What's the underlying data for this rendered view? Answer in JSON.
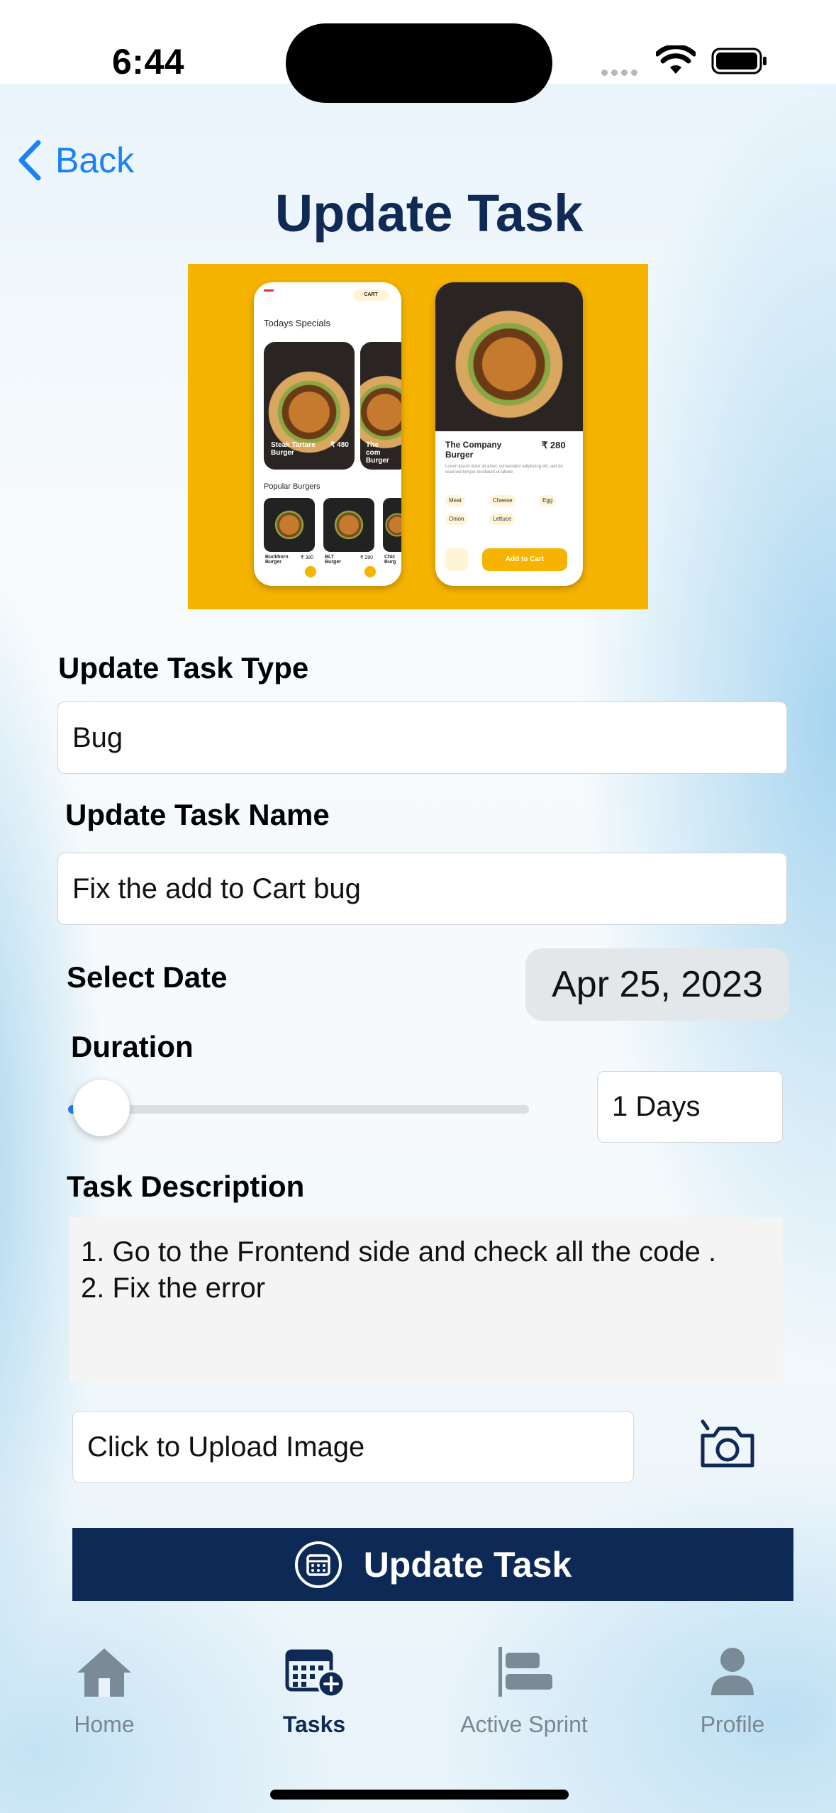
{
  "status_bar": {
    "time": "6:44"
  },
  "nav": {
    "back_label": "Back",
    "title": "Update Task"
  },
  "hero_image": {
    "todays_specials": "Todays Specials",
    "specials_item": "Steak Tartare Burger",
    "specials_item_price": "₹ 480",
    "specials_item_2": "The com Burger",
    "popular": "Popular Burgers",
    "popular_items": [
      "Buckhorn Burger",
      "BLT Burger",
      "Chic Burg"
    ],
    "popular_item_prices": [
      "₹ 380",
      "₹ 280"
    ],
    "detail_title": "The Company Burger",
    "detail_price": "₹ 280",
    "detail_desc": "Lorem ipsum dolor sit amet, consectetur adipiscing elit, sed do eiusmod tempor incididunt ut labore.",
    "toppings": [
      "Meat",
      "Cheese",
      "Egg",
      "Onion",
      "Lettuce"
    ],
    "add_to_cart": "Add to Cart",
    "cart": "CART"
  },
  "form": {
    "task_type_label": "Update Task Type",
    "task_type_value": "Bug",
    "task_name_label": "Update Task Name",
    "task_name_value": "Fix the add to Cart bug",
    "date_label": "Select Date",
    "date_value": "Apr 25, 2023",
    "duration_label": "Duration",
    "duration_value": "1 Days",
    "duration_slider_fraction": 0.0,
    "description_label": "Task Description",
    "description_value": "1. Go to the Frontend side and check all the code .\n2. Fix the error",
    "upload_placeholder": "Click to Upload Image",
    "submit_label": "Update Task"
  },
  "tab_bar": {
    "items": [
      {
        "label": "Home",
        "icon": "home-icon",
        "active": false
      },
      {
        "label": "Tasks",
        "icon": "calendar-plus-icon",
        "active": true
      },
      {
        "label": "Active Sprint",
        "icon": "sprint-bars-icon",
        "active": false
      },
      {
        "label": "Profile",
        "icon": "person-icon",
        "active": false
      }
    ]
  },
  "colors": {
    "accent": "#1a82f5",
    "primary_dark": "#0c2a55",
    "hero_bg": "#f6b400"
  }
}
